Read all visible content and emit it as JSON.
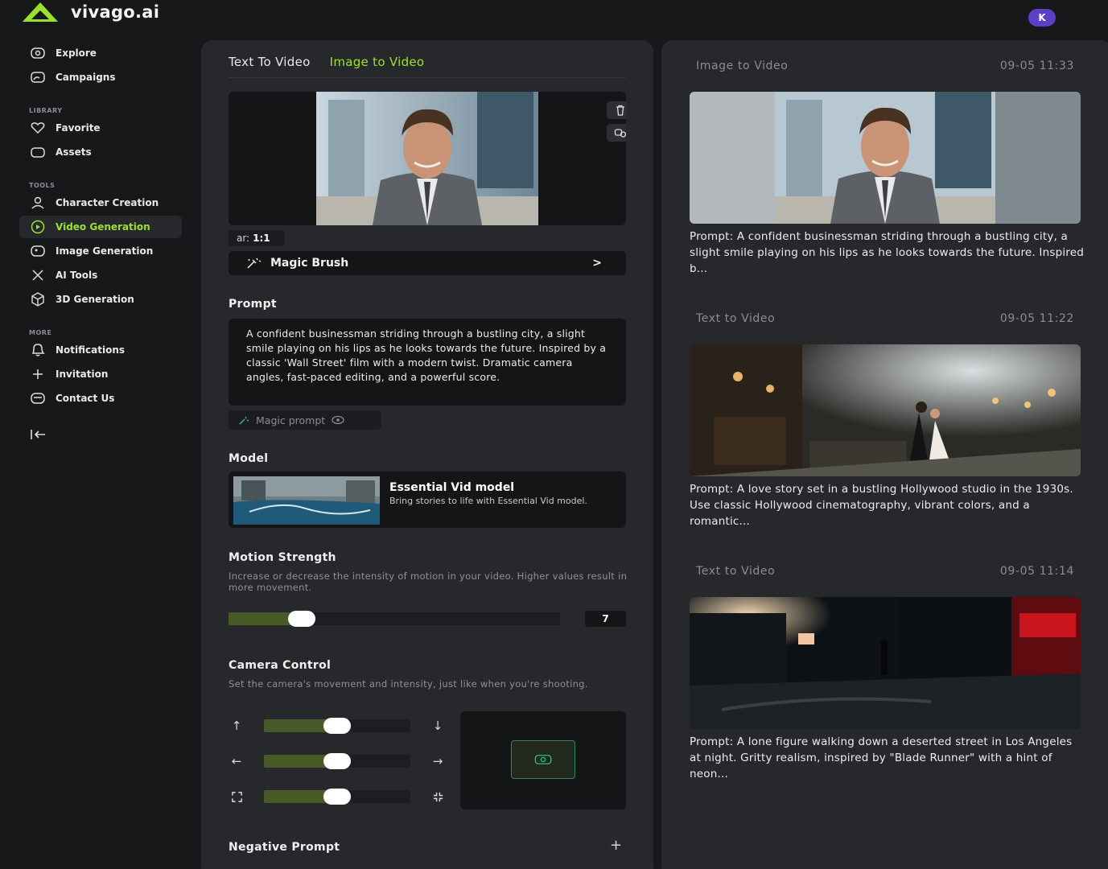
{
  "app": {
    "name": "vivago.ai",
    "avatar_initial": "K",
    "brand_color": "#9be22a"
  },
  "sidebar": {
    "top_items": [
      {
        "label": "Explore",
        "icon": "explore-icon"
      },
      {
        "label": "Campaigns",
        "icon": "campaigns-icon"
      }
    ],
    "library_label": "LIBRARY",
    "library_items": [
      {
        "label": "Favorite",
        "icon": "heart-icon"
      },
      {
        "label": "Assets",
        "icon": "folder-icon"
      }
    ],
    "tools_label": "TOOLS",
    "tools_items": [
      {
        "label": "Character Creation",
        "icon": "character-icon"
      },
      {
        "label": "Video Generation",
        "icon": "video-icon",
        "active": true
      },
      {
        "label": "Image Generation",
        "icon": "image-icon"
      },
      {
        "label": "AI Tools",
        "icon": "ai-tools-icon"
      },
      {
        "label": "3D Generation",
        "icon": "cube-icon"
      }
    ],
    "more_label": "MORE",
    "more_items": [
      {
        "label": "Notifications",
        "icon": "bell-icon"
      },
      {
        "label": "Invitation",
        "icon": "plus-icon"
      },
      {
        "label": "Contact Us",
        "icon": "mail-icon"
      }
    ]
  },
  "generator": {
    "tabs": [
      {
        "label": "Text To Video",
        "active": false
      },
      {
        "label": "Image to Video",
        "active": true
      }
    ],
    "aspect_label": "ar:",
    "aspect_value": "1:1",
    "magic_brush_label": "Magic Brush",
    "prompt_title": "Prompt",
    "prompt_text": "A confident businessman striding through a bustling city, a slight smile playing on his lips as he looks towards the future. Inspired by a classic 'Wall Street' film with a modern twist. Dramatic camera angles, fast-paced editing, and a powerful score.",
    "magic_prompt_label": "Magic prompt",
    "model_title": "Model",
    "model_name": "Essential Vid model",
    "model_desc": "Bring stories to life with Essential Vid model.",
    "motion_title": "Motion Strength",
    "motion_desc": "Increase or decrease the intensity of motion in your video. Higher values result in more movement.",
    "motion_value": "7",
    "motion_fraction": 0.22,
    "camera_title": "Camera Control",
    "camera_desc": "Set the camera's movement and intensity, just like when you're shooting.",
    "camera_sliders": [
      {
        "left_icon": "arrow-up-icon",
        "right_icon": "arrow-down-icon",
        "fraction": 0.5
      },
      {
        "left_icon": "arrow-left-icon",
        "right_icon": "arrow-right-icon",
        "fraction": 0.5
      },
      {
        "left_icon": "zoom-out-icon",
        "right_icon": "zoom-in-icon",
        "fraction": 0.5
      }
    ],
    "negative_prompt_title": "Negative Prompt"
  },
  "history": [
    {
      "type": "Image to Video",
      "time": "09-05 11:33",
      "prompt": "Prompt: A confident businessman striding through a bustling city, a slight smile playing on his lips as he looks towards the future. Inspired b..."
    },
    {
      "type": "Text to Video",
      "time": "09-05 11:22",
      "prompt": "Prompt: A love story set in a bustling Hollywood studio in the 1930s. Use classic Hollywood cinematography, vibrant colors, and a romantic..."
    },
    {
      "type": "Text to Video",
      "time": "09-05 11:14",
      "prompt": "Prompt: A lone figure walking down a deserted street in Los Angeles at night. Gritty realism, inspired by \"Blade Runner\" with a hint of neon..."
    }
  ]
}
